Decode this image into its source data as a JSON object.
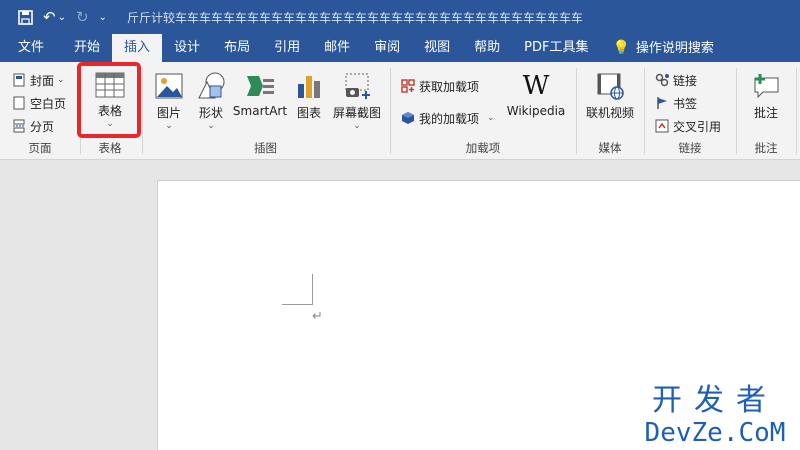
{
  "quick_access": {
    "undo_dropdown": "⌄",
    "customize": "⌄"
  },
  "window": {
    "title": "斤斤计较车车车车车车车车车车车车车车车车车车车车车车车车车车车车车车车车车车"
  },
  "tabs": [
    {
      "label": "文件"
    },
    {
      "label": "开始"
    },
    {
      "label": "插入",
      "active": true
    },
    {
      "label": "设计"
    },
    {
      "label": "布局"
    },
    {
      "label": "引用"
    },
    {
      "label": "邮件"
    },
    {
      "label": "审阅"
    },
    {
      "label": "视图"
    },
    {
      "label": "帮助"
    },
    {
      "label": "PDF工具集"
    },
    {
      "label": "操作说明搜索"
    }
  ],
  "ribbon": {
    "pages": {
      "group_label": "页面",
      "cover": "封面",
      "cover_chev": "⌄",
      "blank_page": "空白页",
      "page_break": "分页"
    },
    "tables": {
      "group_label": "表格",
      "table": "表格",
      "chev": "⌄"
    },
    "illustrations": {
      "group_label": "插图",
      "pictures": "图片",
      "shapes": "形状",
      "smartart": "SmartArt",
      "chart": "图表",
      "screenshot": "屏幕截图",
      "chev": "⌄"
    },
    "addins": {
      "group_label": "加载项",
      "get_addins": "获取加载项",
      "my_addins": "我的加载项",
      "my_addins_chev": "⌄",
      "wikipedia": "Wikipedia",
      "wikipedia_glyph": "W"
    },
    "media": {
      "group_label": "媒体",
      "online_video": "联机视频"
    },
    "links": {
      "group_label": "链接",
      "link": "链接",
      "bookmark": "书签",
      "cross_reference": "交叉引用"
    },
    "comments": {
      "group_label": "批注",
      "comment": "批注"
    }
  },
  "document": {
    "paragraph_mark": "↵"
  },
  "watermark": {
    "line1": "开发者",
    "line2": "DevZe.CoM"
  },
  "colors": {
    "brand": "#2b579a",
    "highlight": "#e8272a",
    "watermark": "#1f5fb5"
  }
}
